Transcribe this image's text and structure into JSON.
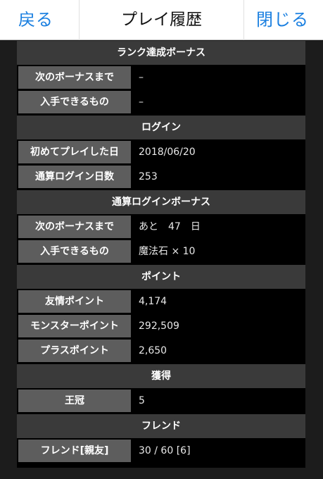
{
  "nav": {
    "back_label": "戻る",
    "title": "プレイ履歴",
    "close_label": "閉じる"
  },
  "sections": [
    {
      "header": "ランク達成ボーナス",
      "rows": [
        {
          "label": "次のボーナスまで",
          "value": "–"
        },
        {
          "label": "入手できるもの",
          "value": "–"
        }
      ]
    },
    {
      "header": "ログイン",
      "rows": [
        {
          "label": "初めてプレイした日",
          "value": "2018/06/20"
        },
        {
          "label": "通算ログイン日数",
          "value": "253"
        }
      ]
    },
    {
      "header": "通算ログインボーナス",
      "rows": [
        {
          "label": "次のボーナスまで",
          "value": "あと　47　日"
        },
        {
          "label": "入手できるもの",
          "value": "魔法石 × 10"
        }
      ]
    },
    {
      "header": "ポイント",
      "rows": [
        {
          "label": "友情ポイント",
          "value": "4,174"
        },
        {
          "label": "モンスターポイント",
          "value": "292,509"
        },
        {
          "label": "プラスポイント",
          "value": "2,650"
        }
      ]
    },
    {
      "header": "獲得",
      "rows": [
        {
          "label": "王冠",
          "value": "5"
        }
      ]
    },
    {
      "header": "フレンド",
      "rows": [
        {
          "label": "フレンド[親友]",
          "value": "30 / 60 [6]"
        }
      ]
    }
  ]
}
